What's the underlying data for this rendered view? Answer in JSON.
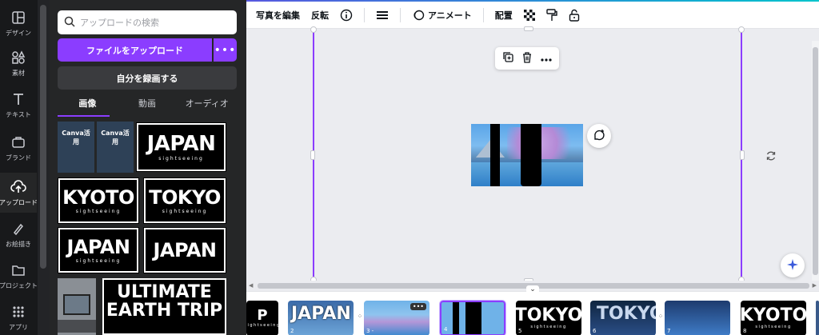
{
  "rail": {
    "items": [
      {
        "label": "デザイン",
        "icon": "layout-icon"
      },
      {
        "label": "素材",
        "icon": "shapes-icon"
      },
      {
        "label": "テキスト",
        "icon": "text-icon"
      },
      {
        "label": "ブランド",
        "icon": "brand-icon"
      },
      {
        "label": "アップロード",
        "icon": "cloud-upload-icon"
      },
      {
        "label": "お絵描き",
        "icon": "draw-icon"
      },
      {
        "label": "プロジェクト",
        "icon": "folder-icon"
      },
      {
        "label": "アプリ",
        "icon": "apps-grid-icon"
      }
    ]
  },
  "panel": {
    "search_placeholder": "アップロードの検索",
    "upload_button": "ファイルをアップロード",
    "record_button": "自分を録画する",
    "tabs": [
      "画像",
      "動画",
      "オーディオ"
    ],
    "thumbs": {
      "canva_title": "Canva活用",
      "japan": "JAPAN",
      "kyoto": "KYOTO",
      "tokyo": "TOKYO",
      "sightseeing": "sightseeing",
      "earth": "ULTIMATE EARTH TRIP"
    }
  },
  "toolbar": {
    "edit_photo": "写真を編集",
    "flip": "反転",
    "animate": "アニメート",
    "position": "配置"
  },
  "filmstrip": {
    "slides": [
      {
        "num": "",
        "text": ""
      },
      {
        "num": "2",
        "text": "JAPAN"
      },
      {
        "num": "3 -",
        "text": ""
      },
      {
        "num": "4",
        "text": ""
      },
      {
        "num": "5",
        "text": "TOKYO"
      },
      {
        "num": "6",
        "text": "TOKYO"
      },
      {
        "num": "7",
        "text": ""
      },
      {
        "num": "8",
        "text": "KYOTO"
      }
    ],
    "sightseeing": "sightseeing"
  },
  "colors": {
    "accent": "#8b3dff",
    "rail_bg": "#18191b",
    "panel_bg": "#252627",
    "canvas_bg": "#ebecf0"
  }
}
